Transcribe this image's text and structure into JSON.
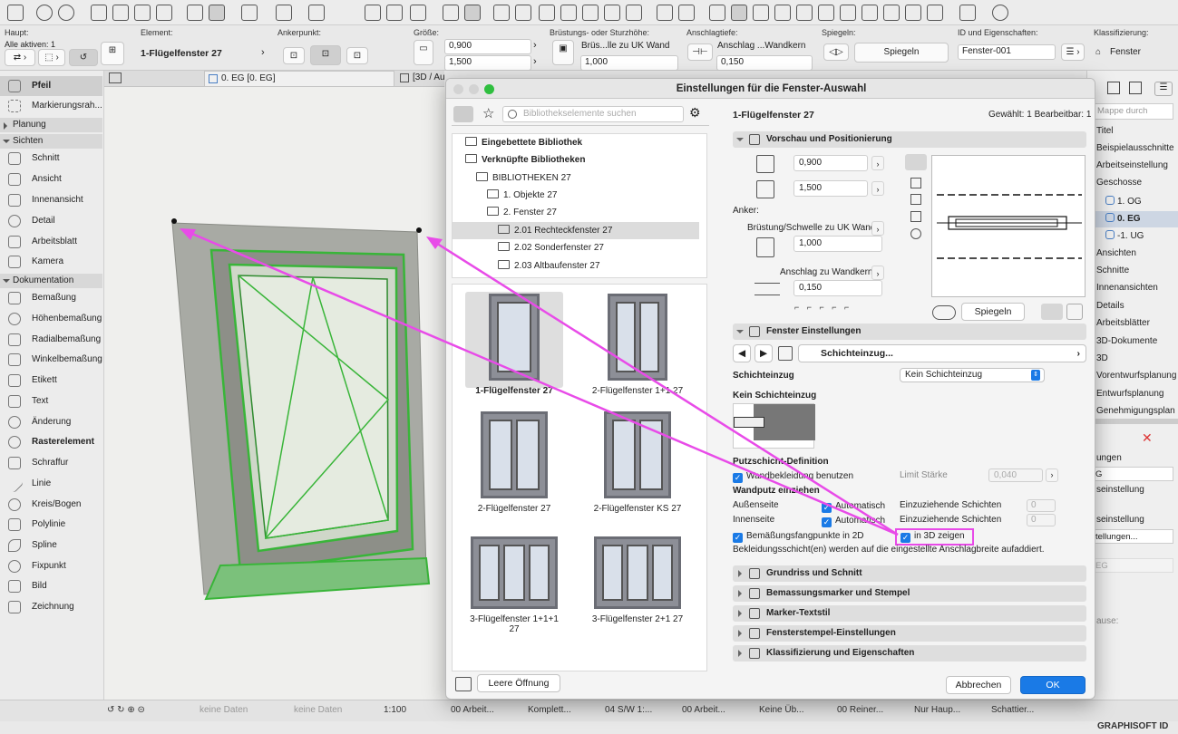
{
  "toolbar": {
    "icons": [
      "save-icon",
      "undo-icon",
      "redo-icon",
      "arrow-select-icon",
      "pipette-icon",
      "injection-icon",
      "marquee-icon",
      "cross-icon",
      "snap-icon",
      "guide-icon",
      "grid-icon",
      "cursor-icon",
      "lock-icon",
      "number-icon",
      "magic-icon",
      "scissors-icon",
      "star-icon",
      "layer-icon",
      "flag-icon",
      "render-icon",
      "3d-icon",
      "sync-icon",
      "view-icon"
    ]
  },
  "infobox": {
    "haupt_label": "Haupt:",
    "alle_aktiven": "Alle aktiven: 1",
    "element_label": "Element:",
    "element_value": "1-Flügelfenster 27",
    "anker_label": "Ankerpunkt:",
    "groesse_label": "Größe:",
    "width": "0,900",
    "height": "1,500",
    "bruestung_label": "Brüstungs- oder Sturzhöhe:",
    "bruestung_value": "Brüs...lle zu UK Wand",
    "bruestung_num": "1,000",
    "anschlag_label": "Anschlagtiefe:",
    "anschlag_value": "Anschlag ...Wandkern",
    "anschlag_num": "0,150",
    "spiegeln_label": "Spiegeln:",
    "spiegeln_btn": "Spiegeln",
    "id_label": "ID und Eigenschaften:",
    "id_value": "Fenster-001",
    "klass_label": "Klassifizierung:",
    "klass_value": "Fenster"
  },
  "tabs": {
    "tab1": "0. EG [0. EG]",
    "tab2": "[3D / Au"
  },
  "toolbox": {
    "tools_top": [
      "Pfeil",
      "Markierungsrah..."
    ],
    "group_planung": "Planung",
    "group_sichten": "Sichten",
    "sichten": [
      "Schnitt",
      "Ansicht",
      "Innenansicht",
      "Detail",
      "Arbeitsblatt",
      "Kamera"
    ],
    "group_doku": "Dokumentation",
    "doku": [
      "Bemaßung",
      "Höhenbemaßung",
      "Radialbemaßung",
      "Winkelbemaßung",
      "Etikett",
      "Text",
      "Änderung",
      "Rasterelement",
      "Schraffur",
      "Linie",
      "Kreis/Bogen",
      "Polylinie",
      "Spline",
      "Fixpunkt",
      "Bild",
      "Zeichnung"
    ]
  },
  "navigator": {
    "search": "Mappe durch",
    "items": [
      "Titel",
      "Beispielausschnitte",
      "Arbeitseinstellung",
      "Geschosse",
      "1. OG",
      "0. EG",
      "-1. UG",
      "Ansichten",
      "Schnitte",
      "Innenansichten",
      "Details",
      "Arbeitsblätter",
      "3D-Dokumente",
      "3D",
      "Vorentwurfsplanung",
      "Entwurfsplanung",
      "Genehmigungsplan"
    ],
    "lower": [
      "ungen",
      "G",
      "seinstellung",
      "seinstellung",
      "tellungen...",
      "EG",
      "ause:"
    ]
  },
  "dialog": {
    "title": "Einstellungen für die Fenster-Auswahl",
    "search_placeholder": "Bibliothekselemente suchen",
    "lib_tree": [
      "Eingebettete Bibliothek",
      "Verknüpfte Bibliotheken",
      "BIBLIOTHEKEN 27",
      "1. Objekte 27",
      "2. Fenster 27",
      "2.01 Rechteckfenster 27",
      "2.02 Sonderfenster 27",
      "2.03 Altbaufenster 27"
    ],
    "thumbs": [
      "1-Flügelfenster 27",
      "2-Flügelfenster 1+1 27",
      "2-Flügelfenster 27",
      "2-Flügelfenster KS 27",
      "3-Flügelfenster 1+1+1 27",
      "3-Flügelfenster 2+1 27"
    ],
    "leere_oeffnung": "Leere Öffnung",
    "element_name": "1-Flügelfenster 27",
    "gewaehlt": "Gewählt: 1 Bearbeitbar: 1",
    "sec_vorschau": "Vorschau und Positionierung",
    "width": "0,900",
    "height": "1,500",
    "anker": "Anker:",
    "bruestung": "Brüstung/Schwelle zu UK Wand",
    "bruestung_num": "1,000",
    "anschlag": "Anschlag zu Wandkern",
    "anschlag_num": "0,150",
    "spiegeln": "Spiegeln",
    "sec_fenster": "Fenster Einstellungen",
    "schichteinzug_nav": "Schichteinzug...",
    "schichteinzug_label": "Schichteinzug",
    "schichteinzug_value": "Kein Schichteinzug",
    "kein_schichteinzug": "Kein Schichteinzug",
    "putz_title": "Putzschicht-Definition",
    "wandbekleidung": "Wandbekleidung benutzen",
    "limit": "Limit Stärke",
    "limit_value": "0,040",
    "wandputz": "Wandputz einziehen",
    "aussen": "Außenseite",
    "innen": "Innenseite",
    "automatisch": "Automatisch",
    "einzuziehende": "Einzuziehende Schichten",
    "zero": "0",
    "bemassung": "Bemäßungsfangpunkte in 2D",
    "in3d": "in 3D zeigen",
    "bekleidung_note": "Bekleidungsschicht(en) werden auf die eingestellte Anschlagbreite aufaddiert.",
    "sec_grundriss": "Grundriss und Schnitt",
    "sec_bemassungsmarker": "Bemassungsmarker und Stempel",
    "sec_marker": "Marker-Textstil",
    "sec_stempel": "Fensterstempel-Einstellungen",
    "sec_klass": "Klassifizierung und Eigenschaften",
    "cancel": "Abbrechen",
    "ok": "OK"
  },
  "status": {
    "keine_daten": "keine Daten",
    "scale": "1:100",
    "items": [
      "00 Arbeit...",
      "Komplett...",
      "04 S/W 1:...",
      "00 Arbeit...",
      "Keine Üb...",
      "00 Reiner...",
      "Nur Haup...",
      "Schattier..."
    ]
  },
  "brand": "GRAPHISOFT ID",
  "colors": {
    "accent": "#1a7ae6",
    "annotation": "#e84be8",
    "window_frame": "#39b539"
  }
}
